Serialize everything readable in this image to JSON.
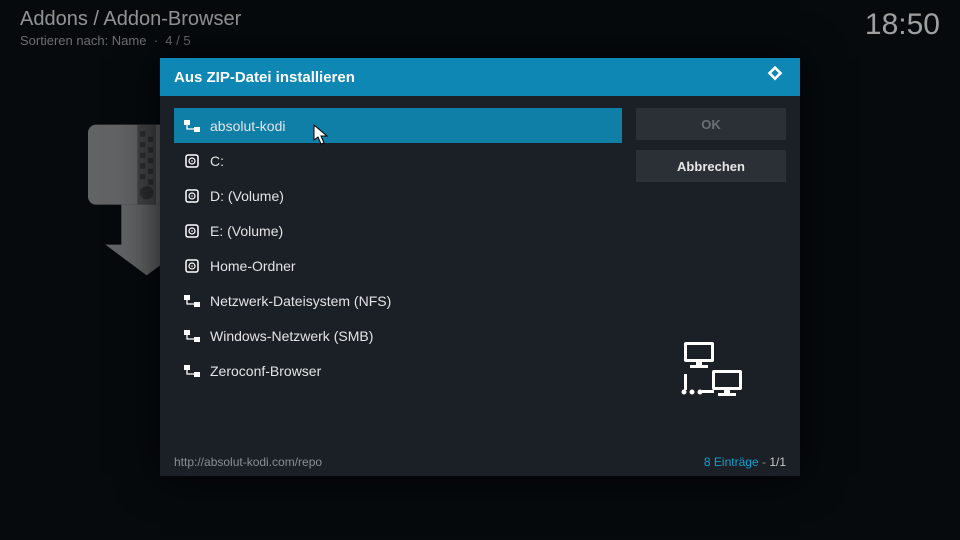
{
  "header": {
    "breadcrumb": "Addons / Addon-Browser",
    "sort_prefix": "Sortieren nach: ",
    "sort_name": "Name",
    "sort_pos": "4 / 5",
    "clock": "18:50"
  },
  "dialog": {
    "title": "Aus ZIP-Datei installieren",
    "ok": "OK",
    "cancel": "Abbrechen",
    "items": [
      {
        "icon": "network",
        "label": "absolut-kodi",
        "selected": true
      },
      {
        "icon": "drive",
        "label": "C:"
      },
      {
        "icon": "drive",
        "label": "D: (Volume)"
      },
      {
        "icon": "drive",
        "label": "E: (Volume)"
      },
      {
        "icon": "drive",
        "label": "Home-Ordner"
      },
      {
        "icon": "network",
        "label": "Netzwerk-Dateisystem (NFS)"
      },
      {
        "icon": "network",
        "label": "Windows-Netzwerk (SMB)"
      },
      {
        "icon": "network",
        "label": "Zeroconf-Browser"
      }
    ],
    "footer_path": "http://absolut-kodi.com/repo",
    "footer_count_label": "Einträge",
    "footer_count": 8,
    "footer_page": "1/1"
  }
}
